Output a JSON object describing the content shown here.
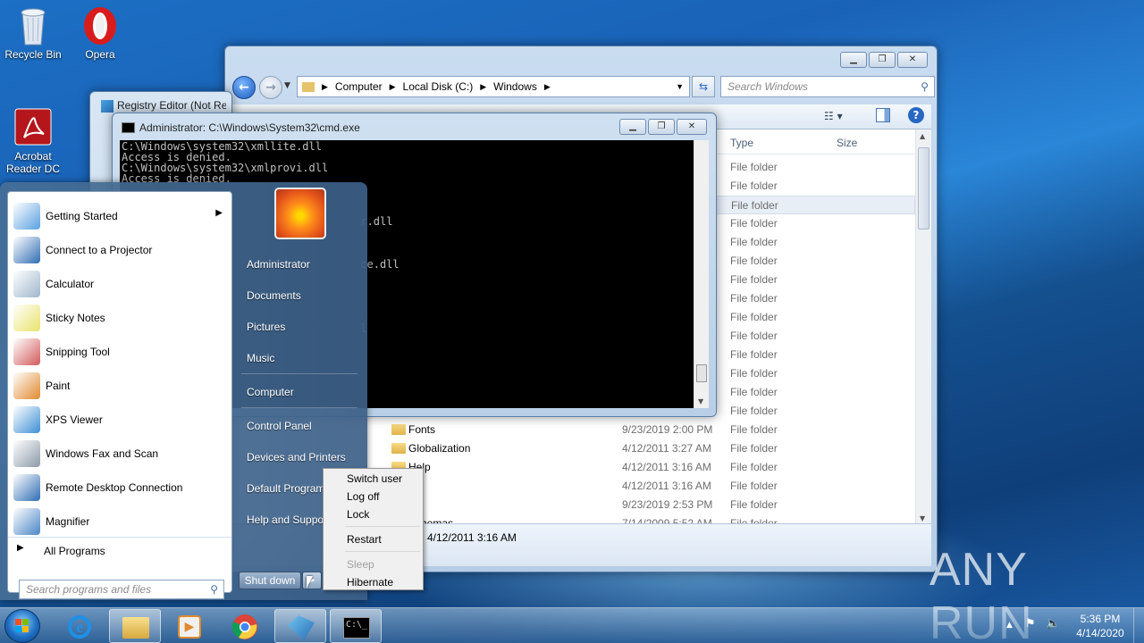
{
  "desktop": {
    "icons": [
      {
        "label": "Recycle Bin"
      },
      {
        "label": "Opera"
      },
      {
        "label": "Acrobat Reader DC"
      }
    ],
    "watermark": "ANY RUN"
  },
  "explorer": {
    "address": [
      "Computer",
      "Local Disk (C:)",
      "Windows"
    ],
    "search_placeholder": "Search Windows",
    "columns": {
      "type": "Type",
      "size": "Size"
    },
    "rows": [
      {
        "name": "",
        "date": "",
        "type": "File folder"
      },
      {
        "name": "",
        "date": "",
        "type": "File folder"
      },
      {
        "name": "",
        "date": "",
        "type": "File folder"
      },
      {
        "name": "",
        "date": "",
        "type": "File folder"
      },
      {
        "name": "",
        "date": "",
        "type": "File folder"
      },
      {
        "name": "",
        "date": "",
        "type": "File folder"
      },
      {
        "name": "",
        "date": "",
        "type": "File folder"
      },
      {
        "name": "",
        "date": "",
        "type": "File folder"
      },
      {
        "name": "",
        "date": "",
        "type": "File folder"
      },
      {
        "name": "",
        "date": "",
        "type": "File folder"
      },
      {
        "name": "",
        "date": "",
        "type": "File folder"
      },
      {
        "name": "",
        "date": "",
        "type": "File folder"
      },
      {
        "name": "",
        "date": "",
        "type": "File folder"
      },
      {
        "name": "",
        "date": "",
        "type": "File folder"
      },
      {
        "name": "Fonts",
        "date": "9/23/2019 2:00 PM",
        "type": "File folder"
      },
      {
        "name": "Globalization",
        "date": "4/12/2011 3:27 AM",
        "type": "File folder"
      },
      {
        "name": "Help",
        "date": "4/12/2011 3:16 AM",
        "type": "File folder"
      },
      {
        "name": "",
        "date": "4/12/2011 3:16 AM",
        "type": "File folder"
      },
      {
        "name": "",
        "date": "9/23/2019 2:53 PM",
        "type": "File folder"
      },
      {
        "name": "Schemas",
        "date": "7/14/2009 5:52 AM",
        "type": "File folder"
      }
    ],
    "details_date": "4/12/2011 3:16 AM"
  },
  "regedit": {
    "title": "Registry Editor (Not Re"
  },
  "cmd": {
    "title": "Administrator: C:\\Windows\\System32\\cmd.exe",
    "lines": [
      "C:\\Windows\\system32\\xmllite.dll",
      "Access is denied.",
      "C:\\Windows\\system32\\xmlprovi.dll",
      "Access is denied.",
      "",
      "",
      "",
      "                                     r.dll",
      "",
      "",
      "",
      "                                     ce.dll",
      "",
      "",
      "",
      "",
      "",
      "                                     l"
    ]
  },
  "startmenu": {
    "programs": [
      {
        "label": "Getting Started",
        "icon": "getting-started-icon",
        "color": "#5aa0e0",
        "arrow": "▶"
      },
      {
        "label": "Connect to a Projector",
        "icon": "projector-icon",
        "color": "#2f6db3",
        "arrow": ""
      },
      {
        "label": "Calculator",
        "icon": "calculator-icon",
        "color": "#9fb6cc",
        "arrow": ""
      },
      {
        "label": "Sticky Notes",
        "icon": "sticky-notes-icon",
        "color": "#e9e36a",
        "arrow": ""
      },
      {
        "label": "Snipping Tool",
        "icon": "scissors-icon",
        "color": "#d35a5a",
        "arrow": ""
      },
      {
        "label": "Paint",
        "icon": "paint-icon",
        "color": "#e08a2e",
        "arrow": ""
      },
      {
        "label": "XPS Viewer",
        "icon": "xps-icon",
        "color": "#3c8fd4",
        "arrow": ""
      },
      {
        "label": "Windows Fax and Scan",
        "icon": "fax-icon",
        "color": "#8c9aa8",
        "arrow": ""
      },
      {
        "label": "Remote Desktop Connection",
        "icon": "remote-desktop-icon",
        "color": "#2f6db3",
        "arrow": ""
      },
      {
        "label": "Magnifier",
        "icon": "magnifier-icon",
        "color": "#4a86c6",
        "arrow": ""
      }
    ],
    "all_programs": "All Programs",
    "search_placeholder": "Search programs and files",
    "right_links": [
      "Administrator",
      "Documents",
      "Pictures",
      "Music",
      "Computer",
      "Control Panel",
      "Devices and Printers",
      "Default Programs",
      "Help and Support"
    ],
    "shutdown": "Shut down"
  },
  "power_menu": {
    "items": [
      "Switch user",
      "Log off",
      "Lock",
      "Restart",
      "Sleep",
      "Hibernate"
    ]
  },
  "taskbar": {
    "clock_time": "5:36 PM",
    "clock_date": "4/14/2020"
  }
}
